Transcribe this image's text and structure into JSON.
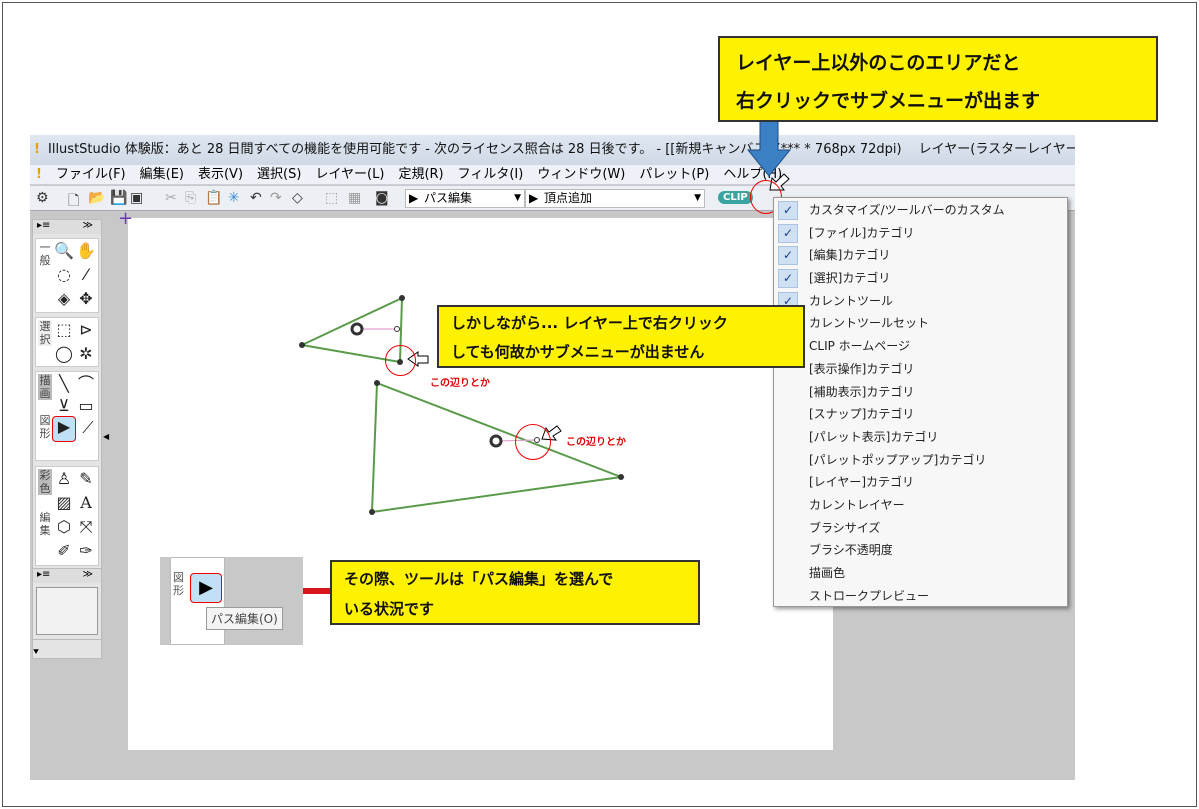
{
  "window": {
    "title": "IllustStudio 体験版：あと 28 日間すべての機能を使用可能です - 次のライセンス照合は 28 日後です。 - [[新規キャンバス] (*** * 768px 72dpi)　 レイヤー(ラスターレイヤー カラ"
  },
  "menu": [
    "ファイル(F)",
    "編集(E)",
    "表示(V)",
    "選択(S)",
    "レイヤー(L)",
    "定規(R)",
    "フィルタ(I)",
    "ウィンドウ(W)",
    "パレット(P)",
    "ヘルプ(H)"
  ],
  "toolbar": {
    "tool_combo": "パス編集",
    "subtool_combo": "頂点追加",
    "clip_button": "CLIP"
  },
  "palette": {
    "groups": [
      "一般",
      "選択",
      "描画",
      "図形",
      "彩色",
      "編集"
    ],
    "text_tool": "A"
  },
  "context_menu": [
    {
      "label": "カスタマイズ/ツールバーのカスタム",
      "checked": true
    },
    {
      "label": "[ファイル]カテゴリ",
      "checked": true
    },
    {
      "label": "[編集]カテゴリ",
      "checked": true
    },
    {
      "label": "[選択]カテゴリ",
      "checked": true
    },
    {
      "label": "カレントツール",
      "checked": true
    },
    {
      "label": "カレントツールセット",
      "checked": false
    },
    {
      "label": "CLIP ホームページ",
      "checked": false
    },
    {
      "label": "[表示操作]カテゴリ",
      "checked": false
    },
    {
      "label": "[補助表示]カテゴリ",
      "checked": false
    },
    {
      "label": "[スナップ]カテゴリ",
      "checked": false
    },
    {
      "label": "[パレット表示]カテゴリ",
      "checked": false
    },
    {
      "label": "[パレットポップアップ]カテゴリ",
      "checked": false
    },
    {
      "label": "[レイヤー]カテゴリ",
      "checked": false
    },
    {
      "label": "カレントレイヤー",
      "checked": false
    },
    {
      "label": "ブラシサイズ",
      "checked": false
    },
    {
      "label": "ブラシ不透明度",
      "checked": false
    },
    {
      "label": "描画色",
      "checked": false
    },
    {
      "label": "ストロークプレビュー",
      "checked": false
    }
  ],
  "callouts": {
    "top": [
      "レイヤー上以外のこのエリアだと",
      "右クリックでサブメニューが出ます"
    ],
    "middle": [
      "しかしながら... レイヤー上で右クリック",
      "しても何故かサブメニューが出ません"
    ],
    "bottom": [
      "その際、ツールは「パス編集」を選んで",
      "いる状況です"
    ],
    "hint1": "この辺りとか",
    "hint2": "この辺りとか"
  },
  "inset": {
    "tooltip": "パス編集(O)",
    "group_label": "図形"
  },
  "colors": {
    "callout_bg": "#fff200",
    "highlight_red": "#e00000",
    "arrow_blue": "#3b7fc4",
    "path_green": "#5a9a4a"
  }
}
